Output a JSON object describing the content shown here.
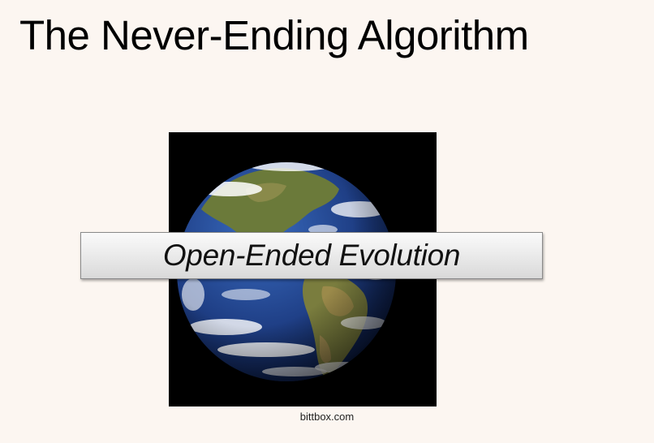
{
  "slide": {
    "title": "The Never-Ending Algorithm",
    "caption": "Open-Ended Evolution",
    "image_credit": "bittbox.com"
  },
  "image": {
    "subject": "earth-globe-icon"
  },
  "colors": {
    "background": "#fcf6f1",
    "ocean": "#1f3f86",
    "land": "#6e7a3c",
    "clouds": "#ffffff",
    "image_frame": "#000000"
  }
}
